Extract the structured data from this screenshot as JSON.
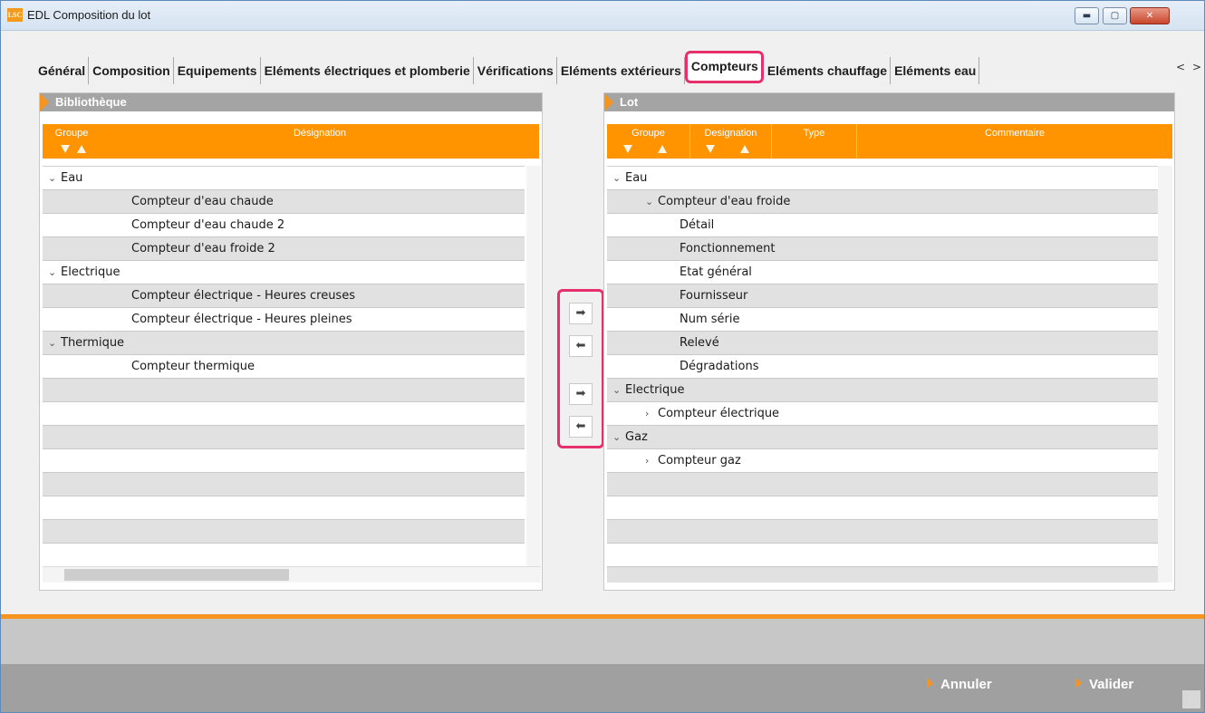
{
  "window": {
    "title": "EDL Composition du lot",
    "app_icon": "LSC",
    "controls": {
      "minimize": "▬",
      "maximize": "▢",
      "close": "✕"
    }
  },
  "tabs": [
    "Général",
    "Composition",
    "Equipements",
    "Eléments électriques et plomberie",
    "Vérifications",
    "Eléments extérieurs",
    "Compteurs",
    "Eléments chauffage",
    "Eléments eau"
  ],
  "active_tab": "Compteurs",
  "tab_nav": {
    "prev": "<",
    "next": ">"
  },
  "library": {
    "title": "Bibliothèque",
    "columns": {
      "group": "Groupe",
      "designation": "Désignation"
    },
    "rows": [
      {
        "text": "Eau",
        "level": 0,
        "chevron": "⌄"
      },
      {
        "text": "Compteur d'eau chaude",
        "level": 2,
        "chevron": ""
      },
      {
        "text": "Compteur d'eau chaude 2",
        "level": 2,
        "chevron": ""
      },
      {
        "text": "Compteur d'eau froide 2",
        "level": 2,
        "chevron": ""
      },
      {
        "text": "Electrique",
        "level": 0,
        "chevron": "⌄"
      },
      {
        "text": "Compteur électrique - Heures creuses",
        "level": 2,
        "chevron": ""
      },
      {
        "text": "Compteur électrique - Heures pleines",
        "level": 2,
        "chevron": ""
      },
      {
        "text": "Thermique",
        "level": 0,
        "chevron": "⌄"
      },
      {
        "text": "Compteur thermique",
        "level": 2,
        "chevron": ""
      },
      {
        "text": "",
        "level": 0,
        "chevron": ""
      },
      {
        "text": "",
        "level": 0,
        "chevron": ""
      },
      {
        "text": "",
        "level": 0,
        "chevron": ""
      },
      {
        "text": "",
        "level": 0,
        "chevron": ""
      },
      {
        "text": "",
        "level": 0,
        "chevron": ""
      },
      {
        "text": "",
        "level": 0,
        "chevron": ""
      },
      {
        "text": "",
        "level": 0,
        "chevron": ""
      },
      {
        "text": "",
        "level": 0,
        "chevron": ""
      }
    ]
  },
  "lot": {
    "title": "Lot",
    "columns": {
      "group": "Groupe",
      "designation": "Designation",
      "type": "Type",
      "comment": "Commentaire"
    },
    "rows": [
      {
        "text": "Eau",
        "level": 0,
        "chevron": "⌄"
      },
      {
        "text": "Compteur d'eau froide",
        "level": 1,
        "chevron": "⌄"
      },
      {
        "text": "Détail",
        "level": 2,
        "chevron": ""
      },
      {
        "text": "Fonctionnement",
        "level": 2,
        "chevron": ""
      },
      {
        "text": "Etat général",
        "level": 2,
        "chevron": ""
      },
      {
        "text": "Fournisseur",
        "level": 2,
        "chevron": ""
      },
      {
        "text": "Num série",
        "level": 2,
        "chevron": ""
      },
      {
        "text": "Relevé",
        "level": 2,
        "chevron": ""
      },
      {
        "text": "Dégradations",
        "level": 2,
        "chevron": ""
      },
      {
        "text": "Electrique",
        "level": 0,
        "chevron": "⌄"
      },
      {
        "text": "Compteur électrique",
        "level": 1,
        "chevron": "›"
      },
      {
        "text": "Gaz",
        "level": 0,
        "chevron": "⌄"
      },
      {
        "text": "Compteur gaz",
        "level": 1,
        "chevron": "›"
      },
      {
        "text": "",
        "level": 0,
        "chevron": ""
      },
      {
        "text": "",
        "level": 0,
        "chevron": ""
      },
      {
        "text": "",
        "level": 0,
        "chevron": ""
      },
      {
        "text": "",
        "level": 0,
        "chevron": ""
      },
      {
        "text": "",
        "level": 0,
        "chevron": ""
      }
    ]
  },
  "transfer_buttons": {
    "add": "➡",
    "remove": "⬅",
    "add_all": "➡",
    "remove_all": "⬅"
  },
  "footer": {
    "cancel": "Annuler",
    "validate": "Valider"
  },
  "colors": {
    "accent": "#ff9300",
    "highlight": "#e5306b",
    "header_gray": "#a4a4a4"
  }
}
